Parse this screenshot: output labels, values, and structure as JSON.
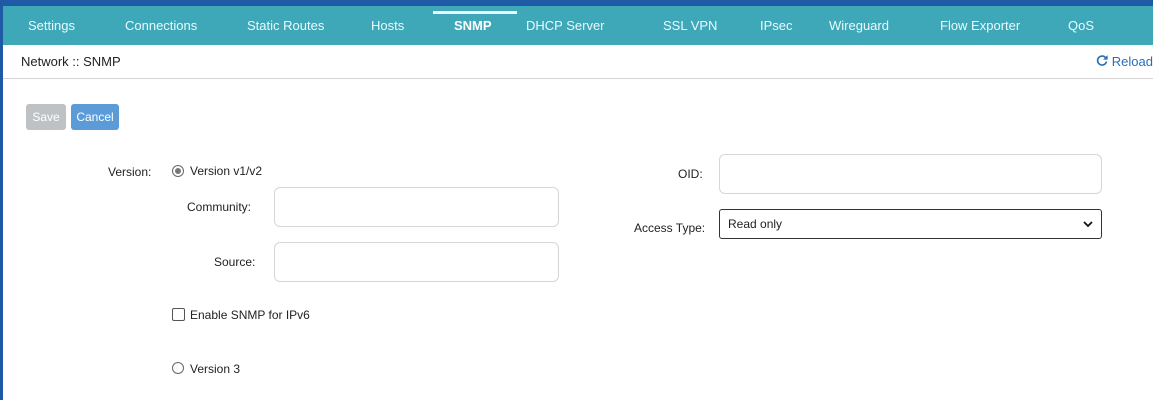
{
  "tabs": [
    {
      "label": "Settings",
      "active": false
    },
    {
      "label": "Connections",
      "active": false
    },
    {
      "label": "Static Routes",
      "active": false
    },
    {
      "label": "Hosts",
      "active": false
    },
    {
      "label": "SNMP",
      "active": true
    },
    {
      "label": "DHCP Server",
      "active": false
    },
    {
      "label": "SSL VPN",
      "active": false
    },
    {
      "label": "IPsec",
      "active": false
    },
    {
      "label": "Wireguard",
      "active": false
    },
    {
      "label": "Flow Exporter",
      "active": false
    },
    {
      "label": "QoS",
      "active": false
    }
  ],
  "breadcrumb": "Network :: SNMP",
  "reload_label": "Reload",
  "buttons": {
    "save": "Save",
    "cancel": "Cancel"
  },
  "form": {
    "version_label": "Version:",
    "version_v1v2": "Version v1/v2",
    "version_v3": "Version 3",
    "selected_version": "Version v1/v2",
    "community_label": "Community:",
    "community_value": "",
    "source_label": "Source:",
    "source_value": "",
    "enable_ipv6_label": "Enable SNMP for IPv6",
    "enable_ipv6_checked": false,
    "oid_label": "OID:",
    "oid_value": "",
    "access_type_label": "Access Type:",
    "access_type_value": "Read only"
  },
  "colors": {
    "tab_bar": "#3fa8b8",
    "frame": "#1f5aa6",
    "save_disabled": "#bfc2c5",
    "cancel": "#5b9bd8",
    "reload": "#2a6fb6"
  }
}
